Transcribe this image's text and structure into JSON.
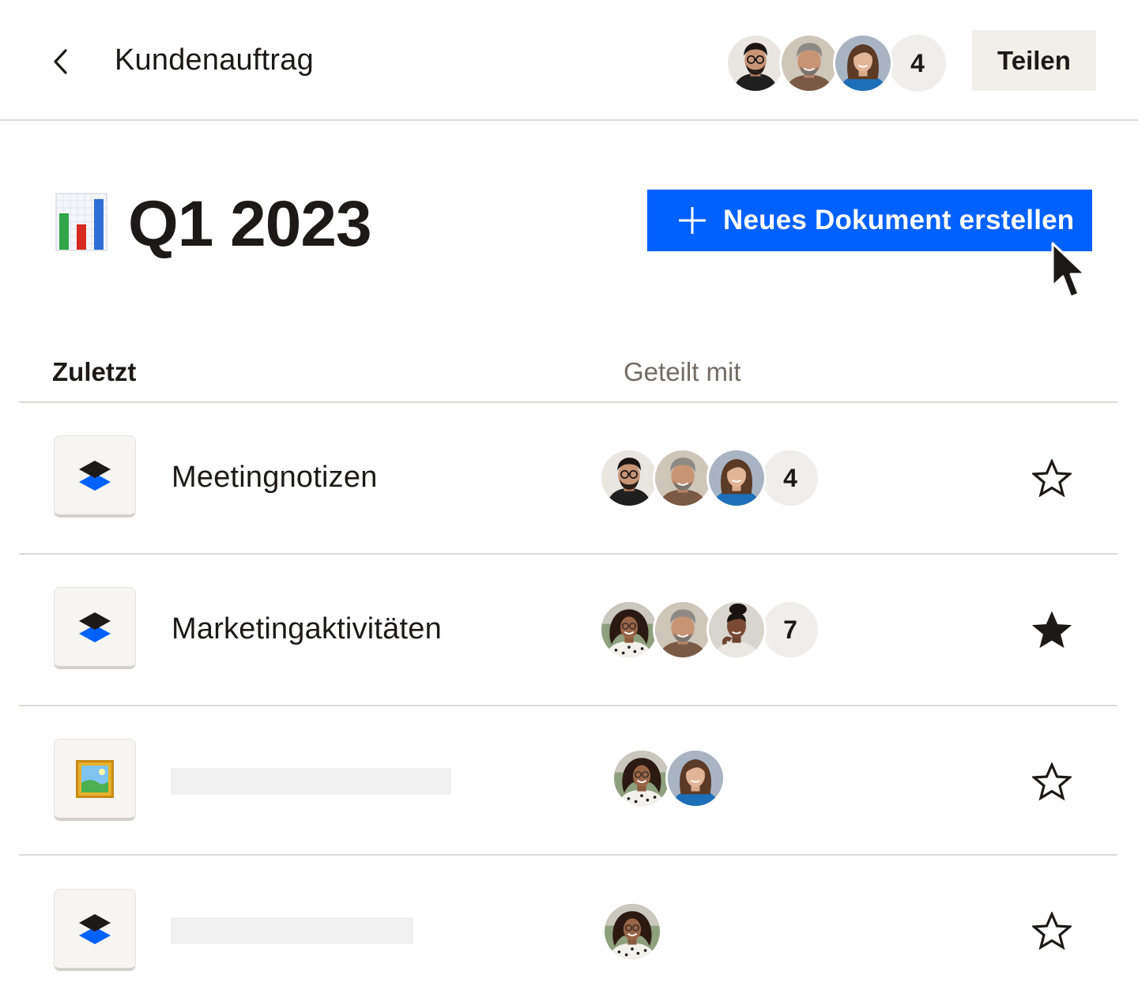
{
  "header": {
    "title": "Kundenauftrag",
    "collaborator_count": "4",
    "share_label": "Teilen",
    "collaborators": [
      "avatar-man-glasses",
      "avatar-man-gray",
      "avatar-woman-brunette"
    ]
  },
  "folder": {
    "emoji": "bar-chart-emoji",
    "title": "Q1 2023",
    "new_doc_label": "Neues Dokument erstellen"
  },
  "table": {
    "col_recent": "Zuletzt",
    "col_shared": "Geteilt mit",
    "rows": [
      {
        "icon": "paper-doc-icon",
        "name": "Meetingnotizen",
        "shared_count": "4",
        "starred": false,
        "avatars": [
          "avatar-man-glasses",
          "avatar-man-gray",
          "avatar-woman-brunette"
        ]
      },
      {
        "icon": "paper-doc-icon",
        "name": "Marketingaktivitäten",
        "shared_count": "7",
        "starred": true,
        "avatars": [
          "avatar-woman-curly",
          "avatar-man-gray",
          "avatar-woman-updo"
        ]
      },
      {
        "icon": "framed-picture-icon",
        "name": "",
        "shared_count": "",
        "starred": false,
        "avatars": [
          "avatar-woman-curly",
          "avatar-woman-brunette"
        ]
      },
      {
        "icon": "paper-doc-icon",
        "name": "",
        "shared_count": "",
        "starred": false,
        "avatars": [
          "avatar-woman-curly"
        ]
      }
    ]
  },
  "colors": {
    "accent_blue": "#0061fe",
    "text": "#1e1919",
    "muted_text": "#736c64",
    "divider": "#dcdad7",
    "button_neutral": "#f2efeb"
  }
}
